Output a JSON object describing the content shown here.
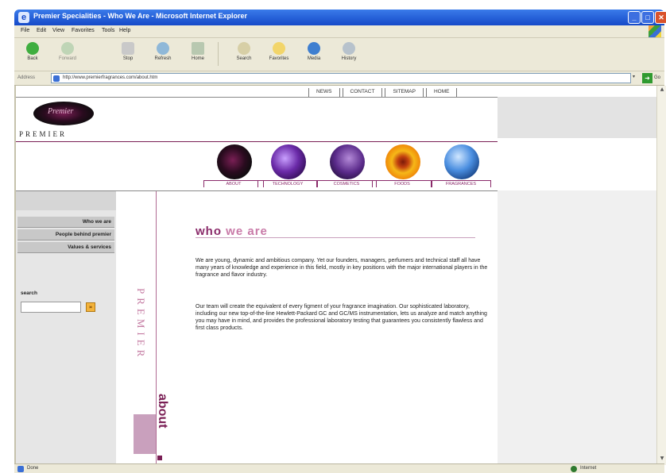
{
  "window": {
    "title": "Premier Specialities - Who We Are - Microsoft Internet Explorer",
    "min_label": "_",
    "max_label": "□",
    "close_label": "✕"
  },
  "menubar": {
    "items": [
      "File",
      "Edit",
      "View",
      "Favorites",
      "Tools",
      "Help"
    ]
  },
  "toolbar": {
    "buttons": [
      "Back",
      "Forward",
      "Stop",
      "Refresh",
      "Home",
      "Search",
      "Favorites",
      "Media",
      "History"
    ]
  },
  "addressbar": {
    "label": "Address",
    "url": "http://www.premierfragrances.com/about.htm",
    "go_label": "Go"
  },
  "page": {
    "top_nav": [
      "NEWS",
      "CONTACT",
      "SITEMAP",
      "HOME"
    ],
    "logo_script": "Premier",
    "logo_word": "PREMIER",
    "section_nav": [
      "ABOUT",
      "TECHNOLOGY",
      "COSMETICS",
      "FOODS",
      "FRAGRANCES"
    ],
    "side_menu": [
      "Who we are",
      "People behind premier",
      "Values & services"
    ],
    "search_label": "search",
    "search_go": "»",
    "vertical_brand": "PREMIER",
    "vertical_section": "about",
    "heading_part1": "who ",
    "heading_part2": "we are",
    "paragraph1": "We are young, dynamic and ambitious company. Yet our founders, managers, perfumers and technical staff all have many years of knowledge and experience in this field, mostly in key positions with the major international players in the fragrance and flavor industry.",
    "paragraph2": "Our team will create the equivalent of every figment of your fragrance imagination. Our sophisticated laboratory, including our new top-of-the-line Hewlett-Packard GC and GC/MS instrumentation, lets us analyze and match anything you may have in mind, and provides the professional laboratory testing that guarantees you consistently flawless and first class products."
  },
  "status": {
    "left": "Done",
    "zone": "Internet"
  },
  "colors": {
    "brand": "#7a1f55",
    "accent_pink": "#c97aa8",
    "xp_blue": "#1549c8"
  }
}
